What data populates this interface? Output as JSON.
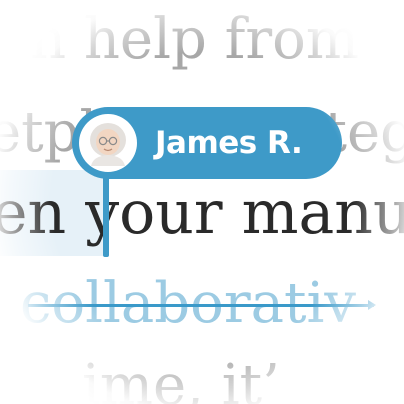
{
  "document": {
    "line_1": "n help from",
    "line_2": "etplace strateg",
    "line_3": "en your manus",
    "line_4": "collaborativ",
    "line_5": "ime, it’"
  },
  "collaborator": {
    "name": "James R.",
    "avatar_icon": "user-avatar-icon",
    "cursor_color": "#3e9ac8"
  },
  "suggestion": {
    "state": "deleted",
    "text_color": "#9ccbe3",
    "strike_color": "#3a99c9"
  },
  "colors": {
    "faded_text": "#a7a7a7",
    "active_text": "#2a2a2a",
    "selection": "#e6f1f8"
  }
}
